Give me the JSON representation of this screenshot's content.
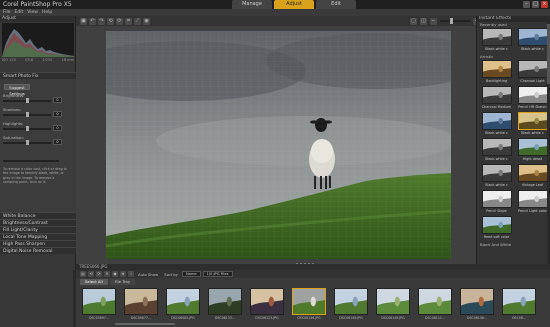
{
  "app": {
    "title": "Corel PaintShop Pro X5",
    "mode_tabs": [
      {
        "label": "Manage",
        "active": false
      },
      {
        "label": "Adjust",
        "active": true
      },
      {
        "label": "Edit",
        "active": false
      }
    ],
    "window_controls": [
      "–",
      "□",
      "×"
    ]
  },
  "menu": [
    "File",
    "Edit",
    "View",
    "Help"
  ],
  "left_panel": {
    "header": "Adjust",
    "histogram_info": [
      "ISO 125",
      "f/5.6",
      "1/250",
      "18 mm"
    ],
    "smart_photo_fix": {
      "title": "Smart Photo Fix",
      "suggest_label": "Suggest Settings",
      "sliders": [
        {
          "label": "Brightness:",
          "value": "0",
          "position": 0.5
        },
        {
          "label": "Shadows:",
          "value": "0",
          "position": 0.5
        },
        {
          "label": "Highlights:",
          "value": "0",
          "position": 0.5
        },
        {
          "label": "Saturation:",
          "value": "0",
          "position": 0.5
        }
      ],
      "hint": "To remove a color cast, click or drag in the image to identify black, white, or gray in the image. To remove a sampling point, click on it."
    },
    "sections": [
      "White Balance",
      "Brightness/Contrast",
      "Fill Light/Clarity",
      "Local Tone Mapping",
      "High Pass Sharpen",
      "Digital Noise Removal"
    ]
  },
  "toolbar": {
    "icons": [
      "save-icon",
      "undo-icon",
      "redo-icon",
      "rotate-left-icon",
      "rotate-right-icon",
      "crop-icon",
      "straighten-icon",
      "red-eye-icon"
    ]
  },
  "right_panel": {
    "header": "Instant Effects",
    "groups": [
      {
        "name": "Recently used",
        "effects": [
          {
            "label": "Black-white c",
            "tone": "bw",
            "selected": false
          },
          {
            "label": "Black-white c",
            "tone": "blue",
            "selected": false
          }
        ]
      },
      {
        "name": "Artistic",
        "effects": [
          {
            "label": "Backlighting",
            "tone": "warm",
            "selected": false
          },
          {
            "label": "Charcoal Light",
            "tone": "bw",
            "selected": false
          },
          {
            "label": "Charcoal Medium",
            "tone": "bw",
            "selected": false
          },
          {
            "label": "Pencil HR Sketch",
            "tone": "sketch",
            "selected": false
          },
          {
            "label": "Black-white c",
            "tone": "blue",
            "selected": false
          },
          {
            "label": "Black-white c",
            "tone": "gold",
            "selected": true
          },
          {
            "label": "Black-white c",
            "tone": "bw",
            "selected": false
          },
          {
            "label": "Hight detail",
            "tone": "natural",
            "selected": false
          },
          {
            "label": "Black-white c",
            "tone": "bw",
            "selected": false
          },
          {
            "label": "Vintage Leaf",
            "tone": "warm",
            "selected": false
          },
          {
            "label": "Pencil Slope",
            "tone": "sketch",
            "selected": false
          },
          {
            "label": "Pencil Light color",
            "tone": "sketch",
            "selected": false
          },
          {
            "label": "Reed soft color",
            "tone": "natural",
            "selected": false
          }
        ]
      },
      {
        "name": "Black And White",
        "effects": []
      }
    ]
  },
  "filmstrip": {
    "header": "TREES066.JPG",
    "toolbar_labels": {
      "auto_show": "Auto Show",
      "sort_by": "Sort by",
      "sort_value": "Name",
      "filter": "1/0 JPG Files"
    },
    "tabs": [
      {
        "label": "Select All",
        "active": true
      },
      {
        "label": "File Tray",
        "active": false
      }
    ],
    "thumbnails": [
      {
        "label": "DSC05697...",
        "tone": "green",
        "selected": false
      },
      {
        "label": "DSC05877...",
        "tone": "church",
        "selected": false
      },
      {
        "label": "DSC06085.JPG",
        "tone": "landscape",
        "selected": false
      },
      {
        "label": "DSC06133...",
        "tone": "tree",
        "selected": false
      },
      {
        "label": "DSC06123.JPG",
        "tone": "people",
        "selected": false
      },
      {
        "label": "DSC06146.JPG",
        "tone": "sheep",
        "selected": true
      },
      {
        "label": "DSC06149.JPG",
        "tone": "landscape",
        "selected": false
      },
      {
        "label": "DSC06149.JPG",
        "tone": "hills",
        "selected": false
      },
      {
        "label": "DSC06111...",
        "tone": "hills",
        "selected": false
      },
      {
        "label": "DSC06106...",
        "tone": "people2",
        "selected": false
      },
      {
        "label": "DSC06...",
        "tone": "landscape",
        "selected": false
      }
    ]
  },
  "colors": {
    "accent": "#d9a21a",
    "background": "#3a3a3a",
    "panel": "#383838"
  }
}
